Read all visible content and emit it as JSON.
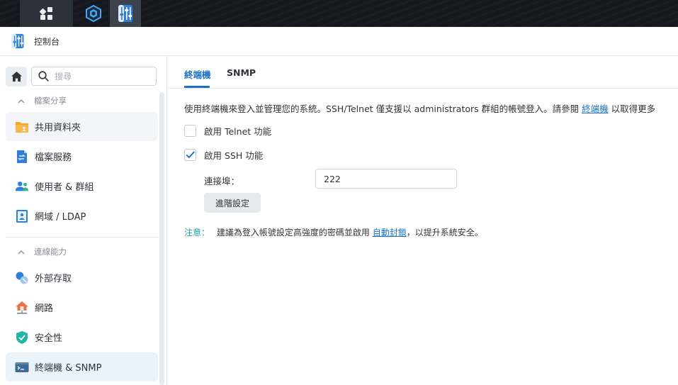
{
  "window": {
    "title": "控制台"
  },
  "search": {
    "placeholder": "搜尋"
  },
  "sidebar": {
    "sections": [
      {
        "label": "檔案分享"
      },
      {
        "label": "連線能力"
      }
    ],
    "items": [
      {
        "label": "共用資料夾",
        "icon": "shared-folder-icon"
      },
      {
        "label": "檔案服務",
        "icon": "file-services-icon"
      },
      {
        "label": "使用者 & 群組",
        "icon": "users-groups-icon"
      },
      {
        "label": "網域 / LDAP",
        "icon": "domain-ldap-icon"
      },
      {
        "label": "外部存取",
        "icon": "external-access-icon"
      },
      {
        "label": "網路",
        "icon": "network-icon"
      },
      {
        "label": "安全性",
        "icon": "security-shield-icon"
      },
      {
        "label": "終端機 & SNMP",
        "icon": "terminal-icon",
        "selected": true
      }
    ]
  },
  "tabs": [
    {
      "label": "終端機",
      "active": true
    },
    {
      "label": "SNMP",
      "active": false
    }
  ],
  "content": {
    "description_prefix": "使用終端機來登入並管理您的系統。SSH/Telnet 僅支援以 administrators 群組的帳號登入。請參閱",
    "description_link": "終端機",
    "description_suffix": "以取得更多",
    "telnet": {
      "label": "啟用 Telnet 功能",
      "checked": false
    },
    "ssh": {
      "label": "啟用 SSH 功能",
      "checked": true
    },
    "port": {
      "label": "連接埠：",
      "value": "222"
    },
    "advanced_button": "進階設定",
    "note_label": "注意：",
    "note_prefix": "建議為登入帳號設定高強度的密碼並啟用",
    "note_link": "自動封鎖",
    "note_suffix": "，以提升系統安全。"
  },
  "colors": {
    "accent": "#1b73c6",
    "note": "#1aa3a3",
    "selected_bg": "#eaf2fa"
  }
}
